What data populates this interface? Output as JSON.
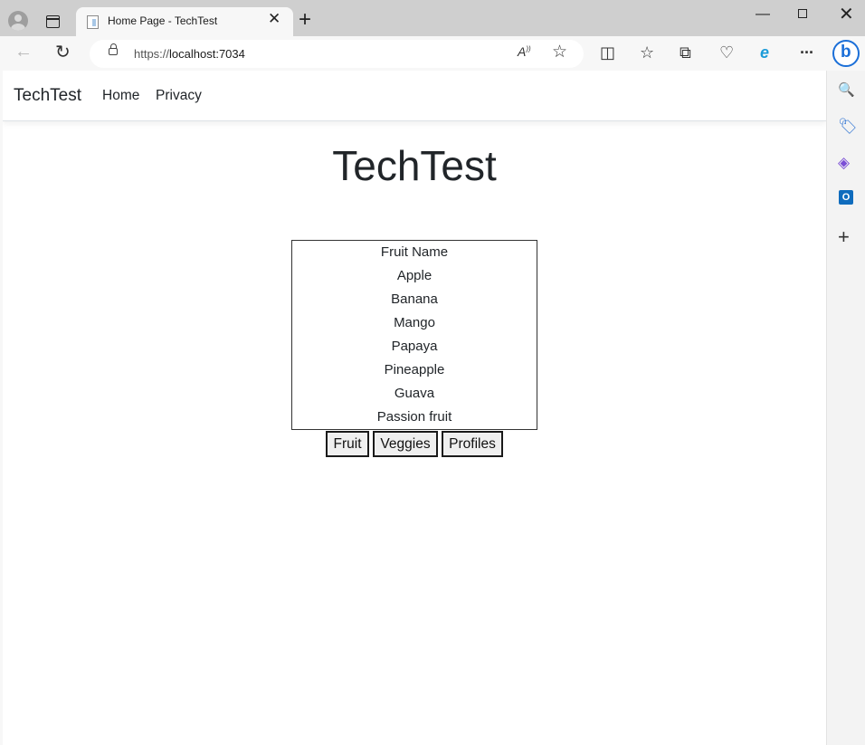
{
  "browser": {
    "tab_title": "Home Page - TechTest",
    "tab_close": "✕",
    "new_tab": "+",
    "url_prefix": "https://",
    "url_host": "localhost:7034",
    "read_aloud": "Aͅ",
    "window_min": "—",
    "window_close": "✕"
  },
  "navbar": {
    "brand": "TechTest",
    "links": [
      "Home",
      "Privacy"
    ]
  },
  "main": {
    "heading": "TechTest",
    "list": [
      "Fruit Name",
      "Apple",
      "Banana",
      "Mango",
      "Papaya",
      "Pineapple",
      "Guava",
      "Passion fruit"
    ],
    "buttons": [
      "Fruit",
      "Veggies",
      "Profiles"
    ]
  },
  "icons": {
    "back": "←",
    "reload": "↻",
    "favorite": "☆",
    "split_screen": "◫",
    "favorites_bar": "☆",
    "collections": "⧉",
    "browser_essentials": "♡",
    "edge_icon": "e",
    "more": "···",
    "search": "🔍",
    "shopping": "🏷",
    "office": "◈",
    "outlook": "O",
    "add": "+",
    "bing": "b"
  },
  "colors": {
    "bing_blue": "#1b6fd8",
    "outlook_blue": "#0f6cbd"
  }
}
